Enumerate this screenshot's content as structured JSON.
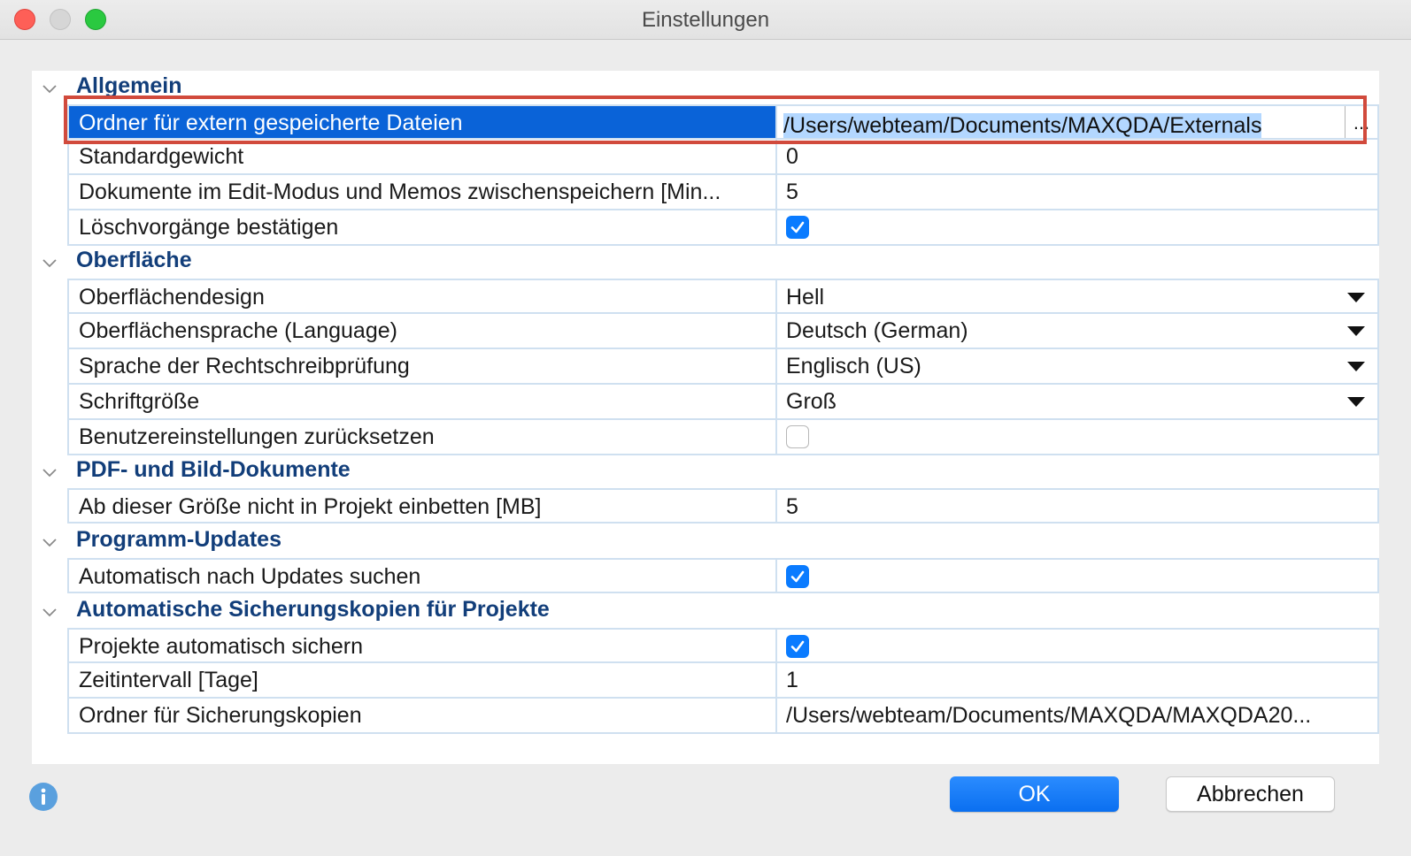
{
  "window": {
    "title": "Einstellungen"
  },
  "sections": [
    {
      "title": "Allgemein",
      "rows": [
        {
          "label": "Ordner für extern gespeicherte Dateien",
          "value": "/Users/webteam/Documents/MAXQDA/Externals",
          "browse": "..."
        },
        {
          "label": "Standardgewicht",
          "value": "0"
        },
        {
          "label": "Dokumente im Edit-Modus und Memos zwischenspeichern [Min...",
          "value": "5"
        },
        {
          "label": "Löschvorgänge bestätigen",
          "checked": true
        }
      ]
    },
    {
      "title": "Oberfläche",
      "rows": [
        {
          "label": "Oberflächendesign",
          "value": "Hell"
        },
        {
          "label": "Oberflächensprache (Language)",
          "value": "Deutsch (German)"
        },
        {
          "label": "Sprache der Rechtschreibprüfung",
          "value": "Englisch (US)"
        },
        {
          "label": "Schriftgröße",
          "value": "Groß"
        },
        {
          "label": "Benutzereinstellungen zurücksetzen",
          "checked": false
        }
      ]
    },
    {
      "title": "PDF- und Bild-Dokumente",
      "rows": [
        {
          "label": "Ab dieser Größe nicht in Projekt einbetten [MB]",
          "value": "5"
        }
      ]
    },
    {
      "title": "Programm-Updates",
      "rows": [
        {
          "label": "Automatisch nach Updates suchen",
          "checked": true
        }
      ]
    },
    {
      "title": "Automatische Sicherungskopien für Projekte",
      "rows": [
        {
          "label": "Projekte automatisch sichern",
          "checked": true
        },
        {
          "label": "Zeitintervall [Tage]",
          "value": "1"
        },
        {
          "label": "Ordner für Sicherungskopien",
          "value": "/Users/webteam/Documents/MAXQDA/MAXQDA20..."
        }
      ]
    }
  ],
  "buttons": {
    "ok": "OK",
    "cancel": "Abbrechen"
  },
  "colors": {
    "accent": "#0a63d8",
    "section_title": "#123e7a",
    "highlight_border": "#d14a3c"
  }
}
